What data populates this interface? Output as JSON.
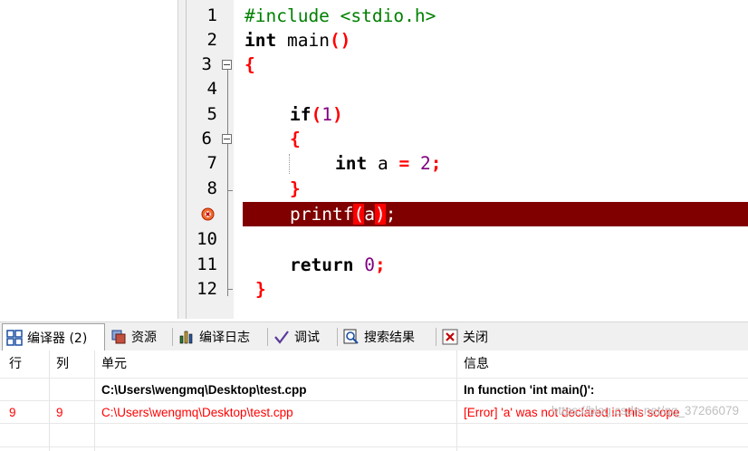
{
  "editor": {
    "lines": [
      {
        "num": "1"
      },
      {
        "num": "2"
      },
      {
        "num": "3"
      },
      {
        "num": "4"
      },
      {
        "num": "5"
      },
      {
        "num": "6"
      },
      {
        "num": "7"
      },
      {
        "num": "8"
      },
      {
        "num": "9"
      },
      {
        "num": "10"
      },
      {
        "num": "11"
      },
      {
        "num": "12"
      }
    ],
    "code": {
      "l1": "#include <stdio.h>",
      "l2_kw": "int",
      "l2_rest": " main",
      "l2_paren": "()",
      "l3": "{",
      "l5_kw": "if",
      "l5_open": "(",
      "l5_num": "1",
      "l5_close": ")",
      "l6": "{",
      "l7_kw": "int",
      "l7_var": " a ",
      "l7_eq": "=",
      "l7_num": " 2",
      "l7_semi": ";",
      "l8": "}",
      "l9_fn": "printf",
      "l9_open": "(",
      "l9_arg": "a",
      "l9_close": ")",
      "l9_semi": ";",
      "l11_kw": "return",
      "l11_num": " 0",
      "l11_semi": ";",
      "l12": "}"
    },
    "error_line_color": "#800000"
  },
  "tabs": [
    {
      "label": "编译器 (2)",
      "icon": "compiler-grid-icon"
    },
    {
      "label": "资源",
      "icon": "resources-icon"
    },
    {
      "label": "编译日志",
      "icon": "bar-chart-icon"
    },
    {
      "label": "调试",
      "icon": "checkmark-icon"
    },
    {
      "label": "搜索结果",
      "icon": "search-results-icon"
    },
    {
      "label": "关闭",
      "icon": "close-icon"
    }
  ],
  "messages": {
    "columns": [
      "行",
      "列",
      "单元",
      "信息"
    ],
    "rows": [
      {
        "line": "",
        "col": "",
        "unit": "C:\\Users\\wengmq\\Desktop\\test.cpp",
        "info": "In function 'int main()':",
        "style": "bold"
      },
      {
        "line": "9",
        "col": "9",
        "unit": "C:\\Users\\wengmq\\Desktop\\test.cpp",
        "info": "[Error] 'a' was not declared in this scope",
        "style": "error"
      }
    ],
    "watermark": "https://blog.csdn.net/qq_37266079"
  }
}
